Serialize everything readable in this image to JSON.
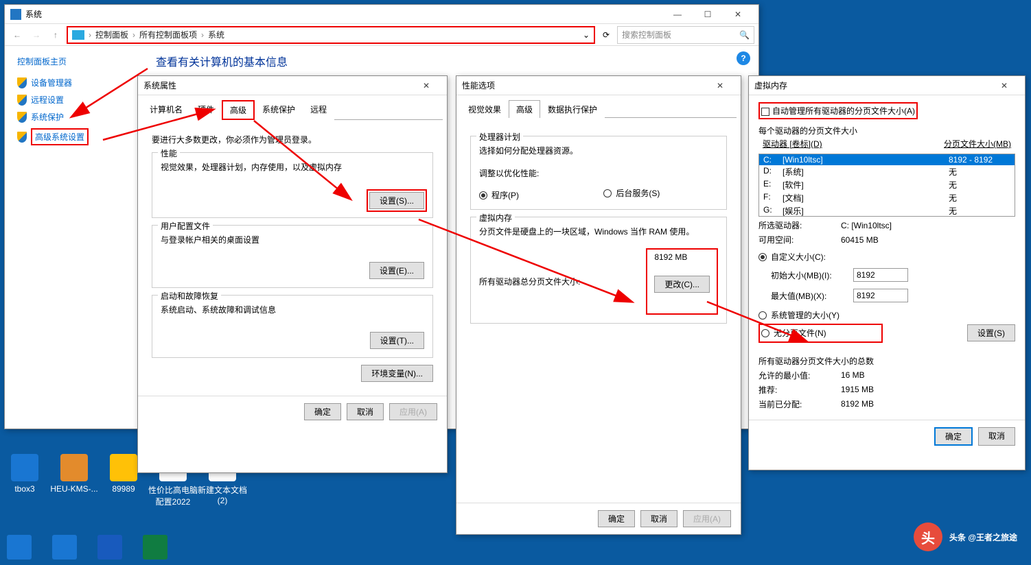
{
  "system_window": {
    "title": "系统",
    "breadcrumb": [
      "控制面板",
      "所有控制面板项",
      "系统"
    ],
    "search_placeholder": "搜索控制面板",
    "sidebar": {
      "home": "控制面板主页",
      "links": [
        "设备管理器",
        "远程设置",
        "系统保护",
        "高级系统设置"
      ]
    },
    "main_heading": "查看有关计算机的基本信息"
  },
  "sys_props": {
    "title": "系统属性",
    "tabs": [
      "计算机名",
      "硬件",
      "高级",
      "系统保护",
      "远程"
    ],
    "admin_note": "要进行大多数更改，你必须作为管理员登录。",
    "perf": {
      "legend": "性能",
      "desc": "视觉效果，处理器计划，内存使用，以及虚拟内存",
      "btn": "设置(S)..."
    },
    "profile": {
      "legend": "用户配置文件",
      "desc": "与登录帐户相关的桌面设置",
      "btn": "设置(E)..."
    },
    "startup": {
      "legend": "启动和故障恢复",
      "desc": "系统启动、系统故障和调试信息",
      "btn": "设置(T)..."
    },
    "env_btn": "环境变量(N)...",
    "ok": "确定",
    "cancel": "取消",
    "apply": "应用(A)"
  },
  "perf_opts": {
    "title": "性能选项",
    "tabs": [
      "视觉效果",
      "高级",
      "数据执行保护"
    ],
    "sched": {
      "legend": "处理器计划",
      "desc": "选择如何分配处理器资源。",
      "adjust": "调整以优化性能:",
      "r1": "程序(P)",
      "r2": "后台服务(S)"
    },
    "vm": {
      "legend": "虚拟内存",
      "desc": "分页文件是硬盘上的一块区域，Windows 当作 RAM 使用。",
      "total_lbl": "所有驱动器总分页文件大小:",
      "total_val": "8192 MB",
      "btn": "更改(C)..."
    },
    "ok": "确定",
    "cancel": "取消",
    "apply": "应用(A)"
  },
  "vm_dlg": {
    "title": "虚拟内存",
    "auto_chk": "自动管理所有驱动器的分页文件大小(A)",
    "each_lbl": "每个驱动器的分页文件大小",
    "drive_hdr": "驱动器 [卷标](D)",
    "size_hdr": "分页文件大小(MB)",
    "drives": [
      {
        "letter": "C:",
        "label": "[Win10ltsc]",
        "size": "8192 - 8192"
      },
      {
        "letter": "D:",
        "label": "[系统]",
        "size": "无"
      },
      {
        "letter": "E:",
        "label": "[软件]",
        "size": "无"
      },
      {
        "letter": "F:",
        "label": "[文档]",
        "size": "无"
      },
      {
        "letter": "G:",
        "label": "[娱乐]",
        "size": "无"
      }
    ],
    "sel_drive_lbl": "所选驱动器:",
    "sel_drive_val": "C:  [Win10ltsc]",
    "avail_lbl": "可用空间:",
    "avail_val": "60415 MB",
    "custom": "自定义大小(C):",
    "init_lbl": "初始大小(MB)(I):",
    "init_val": "8192",
    "max_lbl": "最大值(MB)(X):",
    "max_val": "8192",
    "sys_managed": "系统管理的大小(Y)",
    "no_page": "无分页文件(N)",
    "set_btn": "设置(S)",
    "totals_lbl": "所有驱动器分页文件大小的总数",
    "min_lbl": "允许的最小值:",
    "min_val": "16 MB",
    "rec_lbl": "推荐:",
    "rec_val": "1915 MB",
    "cur_lbl": "当前已分配:",
    "cur_val": "8192 MB",
    "ok": "确定",
    "cancel": "取消"
  },
  "desktop": {
    "icons_r1": [
      "tbox3",
      "HEU-KMS-...",
      "89989",
      "性价比高电脑配置2022",
      "新建文本文档 (2)"
    ],
    "num2": "(2)"
  },
  "watermark": "头条 @王者之旅途"
}
